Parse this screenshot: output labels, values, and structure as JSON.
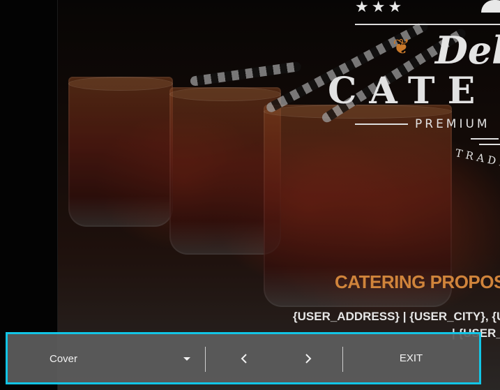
{
  "cover": {
    "logo_title_script": "Del",
    "logo_title_main": "CATE",
    "logo_subtitle": "PREMIUM",
    "logo_trade": "TRADI",
    "proposal_title": "CATERING PROPOS",
    "address_line": "{USER_ADDRESS} | {USER_CITY}, {US",
    "address_line2": "| {USER_"
  },
  "toolbar": {
    "page_select_value": "Cover",
    "prev_icon": "chevron-left-icon",
    "next_icon": "chevron-right-icon",
    "exit_label": "EXIT",
    "accent_color": "#12c5e6"
  },
  "colors": {
    "proposal_title": "#d0843b",
    "toolbar_bg": "#5c5c5c"
  }
}
